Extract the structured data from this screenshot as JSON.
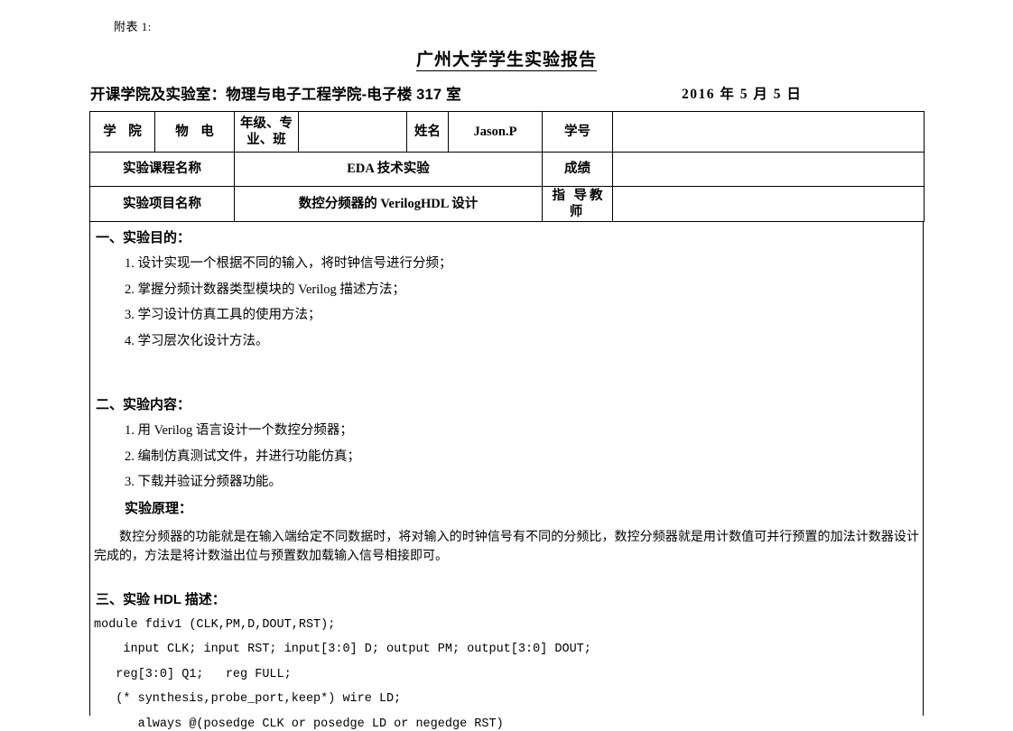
{
  "document": {
    "annotation": "附表 1:",
    "title": "广州大学学生实验报告",
    "subtitle_left": "开课学院及实验室：物理与电子工程学院-电子楼 317 室",
    "date": "2016 年 5 月 5 日"
  },
  "info_table": {
    "row1": {
      "label_college": "学 院",
      "value_college": "物 电",
      "label_grade_major_class": "年级、专业、班",
      "value_grade_major_class": "",
      "label_name": "姓名",
      "value_name": "Jason.P",
      "label_student_id": "学号",
      "value_student_id": ""
    },
    "row2": {
      "label_course": "实验课程名称",
      "value_course": "EDA 技术实验",
      "label_score": "成绩",
      "value_score": ""
    },
    "row3": {
      "label_project": "实验项目名称",
      "value_project": "数控分频器的 VerilogHDL 设计",
      "label_instructor": "指 导教 师",
      "value_instructor": ""
    }
  },
  "sections": {
    "purpose": {
      "heading": "一、实验目的：",
      "items": [
        "1. 设计实现一个根据不同的输入，将时钟信号进行分频；",
        "2. 掌握分频计数器类型模块的 Verilog 描述方法；",
        "3. 学习设计仿真工具的使用方法；",
        "4. 学习层次化设计方法。"
      ]
    },
    "content": {
      "heading": "二、实验内容：",
      "items": [
        "1. 用 Verilog 语言设计一个数控分频器；",
        "2. 编制仿真测试文件，并进行功能仿真；",
        "3. 下载并验证分频器功能。"
      ],
      "principle_heading": "实验原理：",
      "principle_text": "数控分频器的功能就是在输入端给定不同数据时，将对输入的时钟信号有不同的分频比，数控分频器就是用计数值可并行预置的加法计数器设计完成的，方法是将计数溢出位与预置数加载输入信号相接即可。"
    },
    "hdl": {
      "heading": "三、实验 HDL 描述：",
      "code_lines": [
        "module fdiv1 (CLK,PM,D,DOUT,RST);",
        "    input CLK; input RST; input[3:0] D; output PM; output[3:0] DOUT;",
        "   reg[3:0] Q1;   reg FULL;",
        "   (* synthesis,probe_port,keep*) wire LD;",
        "      always @(posedge CLK or posedge LD or negedge RST)"
      ]
    }
  }
}
